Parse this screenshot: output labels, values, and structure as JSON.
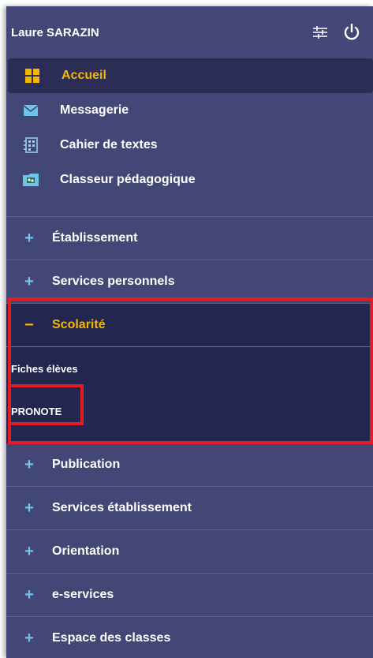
{
  "header": {
    "user_name": "Laure SARAZIN",
    "settings_icon": "sliders-icon",
    "logout_icon": "power-icon"
  },
  "quick_links": [
    {
      "label": "Accueil",
      "icon": "grid-icon",
      "active": true
    },
    {
      "label": "Messagerie",
      "icon": "envelope-icon"
    },
    {
      "label": "Cahier de textes",
      "icon": "notebook-icon"
    },
    {
      "label": "Classeur pédagogique",
      "icon": "folder-icon"
    }
  ],
  "sections": {
    "etablissement": {
      "sign": "+",
      "label": "Établissement"
    },
    "services_personnels": {
      "sign": "+",
      "label": "Services personnels"
    },
    "scolarite": {
      "sign": "−",
      "label": "Scolarité",
      "sub_items": [
        "Fiches élèves",
        "PRONOTE"
      ]
    },
    "publication": {
      "sign": "+",
      "label": "Publication"
    },
    "services_etablissement": {
      "sign": "+",
      "label": "Services établissement"
    },
    "orientation": {
      "sign": "+",
      "label": "Orientation"
    },
    "e_services": {
      "sign": "+",
      "label": "e-services"
    },
    "espace_classes": {
      "sign": "+",
      "label": "Espace des classes"
    }
  },
  "colors": {
    "panel": "#434776",
    "active_bg": "#23264f",
    "accent": "#f5b800",
    "plus": "#6fc3e8",
    "highlight": "#e41c24"
  }
}
